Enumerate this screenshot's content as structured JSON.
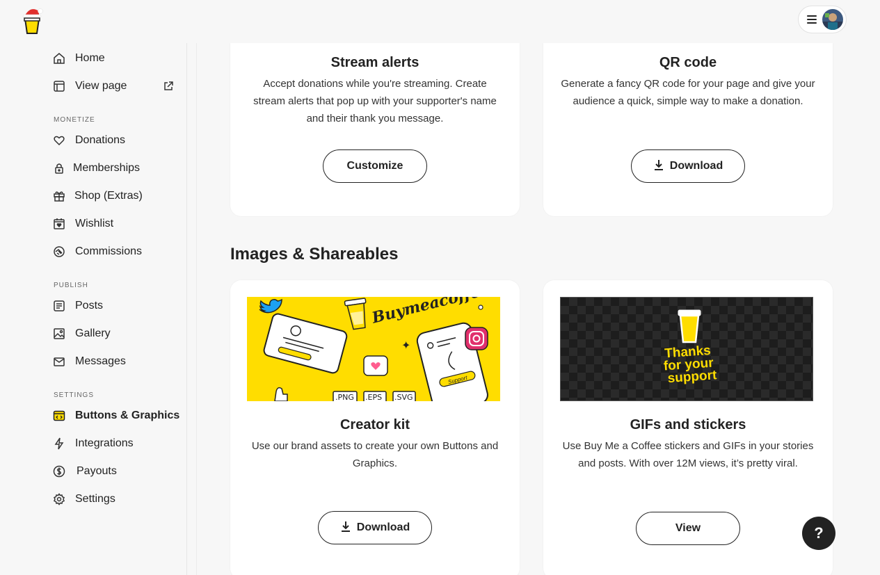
{
  "app": {
    "logo_icon": "coffee-cup-santa-hat-icon"
  },
  "header": {
    "menu_icon": "hamburger-icon",
    "avatar_icon": "user-avatar"
  },
  "sidebar": {
    "items_top": [
      {
        "label": "Home",
        "icon": "home-icon"
      },
      {
        "label": "View page",
        "icon": "layout-icon",
        "trailing_icon": "external-link-icon"
      }
    ],
    "sections": [
      {
        "title": "MONETIZE",
        "items": [
          {
            "label": "Donations",
            "icon": "heart-icon"
          },
          {
            "label": "Memberships",
            "icon": "lock-icon"
          },
          {
            "label": "Shop (Extras)",
            "icon": "gift-icon"
          },
          {
            "label": "Wishlist",
            "icon": "calendar-heart-icon"
          },
          {
            "label": "Commissions",
            "icon": "handshake-icon"
          }
        ]
      },
      {
        "title": "PUBLISH",
        "items": [
          {
            "label": "Posts",
            "icon": "document-icon"
          },
          {
            "label": "Gallery",
            "icon": "image-icon"
          },
          {
            "label": "Messages",
            "icon": "mail-icon"
          }
        ]
      },
      {
        "title": "SETTINGS",
        "items": [
          {
            "label": "Buttons & Graphics",
            "icon": "code-window-icon",
            "active": true
          },
          {
            "label": "Integrations",
            "icon": "bolt-icon"
          },
          {
            "label": "Payouts",
            "icon": "dollar-circle-icon"
          },
          {
            "label": "Settings",
            "icon": "gear-icon"
          }
        ]
      }
    ]
  },
  "main": {
    "cards_top": [
      {
        "title": "Stream alerts",
        "description": "Accept donations while you're streaming. Create stream alerts that pop up with your supporter's name and their thank you message.",
        "button": "Customize"
      },
      {
        "title": "QR code",
        "description": "Generate a fancy QR code for your page and give your audience a quick, simple way to make a donation.",
        "button": "Download",
        "button_icon": "download-icon"
      }
    ],
    "section_title": "Images & Shareables",
    "cards_bottom": [
      {
        "title": "Creator kit",
        "description": "Use our brand assets to create your own Buttons and Graphics.",
        "button": "Download",
        "button_icon": "download-icon",
        "banner": {
          "brand_text": "Buymeacoffee",
          "badge_text": "Support",
          "formats": [
            ".PNG",
            ".EPS",
            ".SVG"
          ],
          "bg_color": "#ffdd00"
        }
      },
      {
        "title": "GIFs and stickers",
        "description": "Use Buy Me a Coffee stickers and GIFs in your stories and posts. With over 12M views, it’s pretty viral.",
        "button": "View",
        "banner": {
          "sticker_text_lines": [
            "Thanks",
            "for your",
            "support"
          ],
          "accent_color": "#ffdd00"
        }
      }
    ]
  },
  "help": {
    "label": "?"
  }
}
